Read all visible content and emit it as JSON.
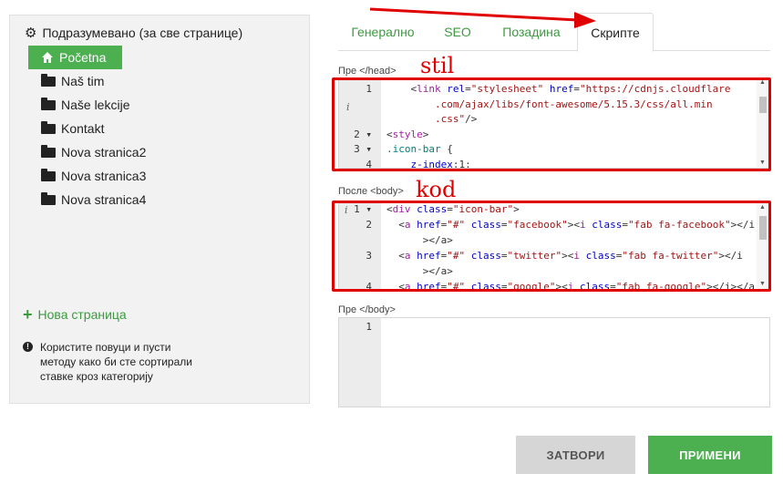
{
  "sidebar": {
    "root_label": "Подразумевано (за све странице)",
    "pages": [
      {
        "label": "Početna",
        "icon": "home-icon",
        "active": true
      },
      {
        "label": "Naš tim",
        "icon": "folder-icon"
      },
      {
        "label": "Naše lekcije",
        "icon": "folder-icon"
      },
      {
        "label": "Kontakt",
        "icon": "folder-icon"
      },
      {
        "label": "Nova stranica2",
        "icon": "folder-icon"
      },
      {
        "label": "Nova stranica3",
        "icon": "folder-icon"
      },
      {
        "label": "Nova stranica4",
        "icon": "folder-icon"
      }
    ],
    "new_page_label": "Нова страница",
    "hint": "Користите повуци и пусти методу како би сте сортирали ставке кроз категорију"
  },
  "tabs": [
    {
      "label": "Генерално"
    },
    {
      "label": "SEO"
    },
    {
      "label": "Позадина"
    },
    {
      "label": "Скрипте",
      "active": true
    }
  ],
  "annotations": {
    "stil": "stil",
    "kod": "kod"
  },
  "head_section": {
    "label": "Пре </head>",
    "lines": [
      {
        "n": "1",
        "parts": [
          [
            "t",
            "    "
          ],
          [
            "t",
            "<"
          ],
          [
            "kw",
            "link "
          ],
          [
            "at",
            "rel"
          ],
          [
            "t",
            "="
          ],
          [
            "st",
            "\"stylesheet\" "
          ],
          [
            "at",
            "href"
          ],
          [
            "t",
            "="
          ],
          [
            "st",
            "\"https://cdnjs.cloudflare"
          ]
        ]
      },
      {
        "n": "",
        "parts": [
          [
            "st",
            "        .com/ajax/libs/font-awesome/5.15.3/css/all.min"
          ]
        ]
      },
      {
        "n": "",
        "parts": [
          [
            "st",
            "        .css\""
          ],
          [
            "t",
            "/>"
          ]
        ]
      },
      {
        "n": "2 ▾",
        "parts": [
          [
            "t",
            "<"
          ],
          [
            "kw",
            "style"
          ],
          [
            "t",
            ">"
          ]
        ]
      },
      {
        "n": "3 ▾",
        "parts": [
          [
            "sel",
            ".icon-bar "
          ],
          [
            "t",
            "{"
          ]
        ]
      },
      {
        "n": "4",
        "parts": [
          [
            "t",
            "    "
          ],
          [
            "at",
            "z-index"
          ],
          [
            "t",
            ":1;"
          ]
        ]
      }
    ]
  },
  "body_section": {
    "label": "После <body>",
    "lines": [
      {
        "n": "1 ▾",
        "parts": [
          [
            "t",
            "<"
          ],
          [
            "kw",
            "div "
          ],
          [
            "at",
            "class"
          ],
          [
            "t",
            "="
          ],
          [
            "st",
            "\"icon-bar\""
          ],
          [
            "t",
            ">"
          ]
        ]
      },
      {
        "n": "2",
        "parts": [
          [
            "t",
            "  <"
          ],
          [
            "kw",
            "a "
          ],
          [
            "at",
            "href"
          ],
          [
            "t",
            "="
          ],
          [
            "st",
            "\"#\" "
          ],
          [
            "at",
            "class"
          ],
          [
            "t",
            "="
          ],
          [
            "st",
            "\"facebook\""
          ],
          [
            "t",
            "><"
          ],
          [
            "kw",
            "i "
          ],
          [
            "at",
            "class"
          ],
          [
            "t",
            "="
          ],
          [
            "st",
            "\"fab fa-facebook\""
          ],
          [
            "t",
            "></i"
          ]
        ]
      },
      {
        "n": "",
        "parts": [
          [
            "t",
            "      ></a>"
          ]
        ]
      },
      {
        "n": "3",
        "parts": [
          [
            "t",
            "  <"
          ],
          [
            "kw",
            "a "
          ],
          [
            "at",
            "href"
          ],
          [
            "t",
            "="
          ],
          [
            "st",
            "\"#\" "
          ],
          [
            "at",
            "class"
          ],
          [
            "t",
            "="
          ],
          [
            "st",
            "\"twitter\""
          ],
          [
            "t",
            "><"
          ],
          [
            "kw",
            "i "
          ],
          [
            "at",
            "class"
          ],
          [
            "t",
            "="
          ],
          [
            "st",
            "\"fab fa-twitter\""
          ],
          [
            "t",
            "></i"
          ]
        ]
      },
      {
        "n": "",
        "parts": [
          [
            "t",
            "      ></a>"
          ]
        ]
      },
      {
        "n": "4",
        "parts": [
          [
            "t",
            "  <"
          ],
          [
            "kw",
            "a "
          ],
          [
            "at",
            "href"
          ],
          [
            "t",
            "="
          ],
          [
            "st",
            "\"#\" "
          ],
          [
            "at",
            "class"
          ],
          [
            "t",
            "="
          ],
          [
            "st",
            "\"google\""
          ],
          [
            "t",
            "><"
          ],
          [
            "kw",
            "i "
          ],
          [
            "at",
            "class"
          ],
          [
            "t",
            "="
          ],
          [
            "st",
            "\"fab fa-google\""
          ],
          [
            "t",
            "></i></a"
          ]
        ]
      }
    ]
  },
  "end_section": {
    "label": "Пре </body>",
    "lines": [
      {
        "n": "1",
        "parts": [
          [
            "t",
            ""
          ]
        ]
      }
    ]
  },
  "buttons": {
    "close": "ЗАТВОРИ",
    "apply": "ПРИМЕНИ"
  },
  "colors": {
    "accent": "#4caf50",
    "annotation": "#e00000"
  }
}
